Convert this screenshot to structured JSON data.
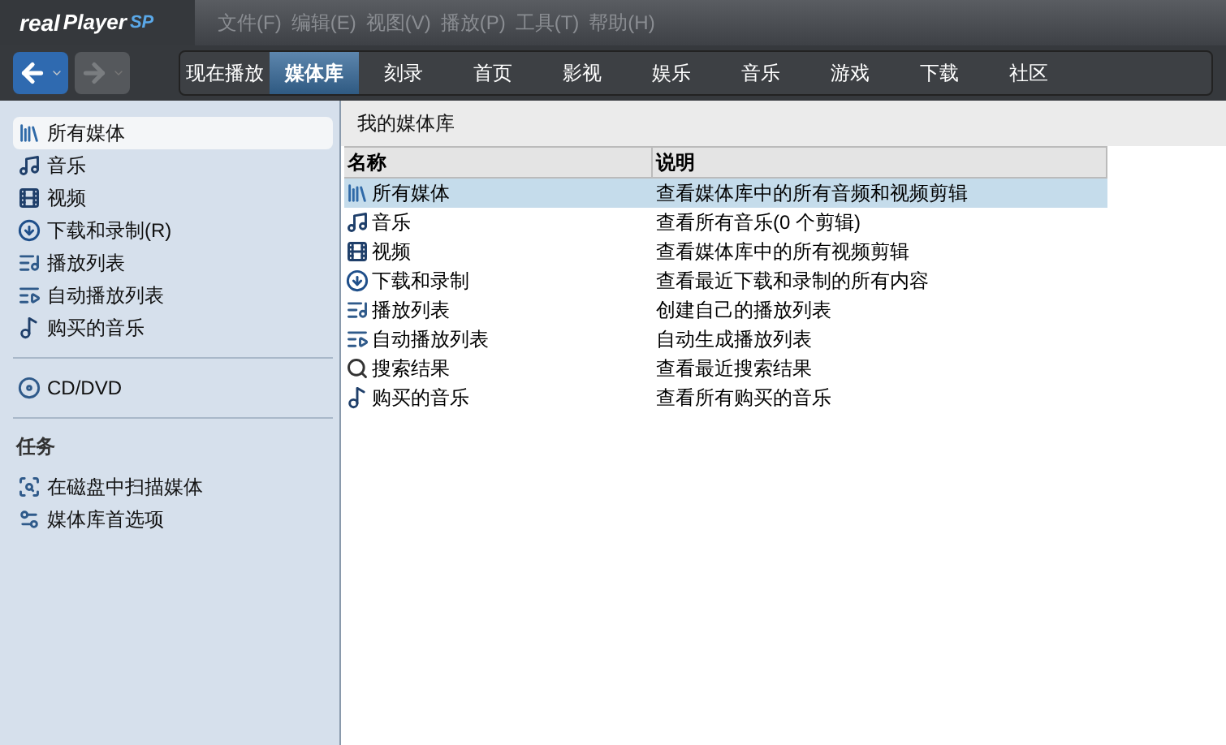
{
  "logo": {
    "brand": "real",
    "product": "Player",
    "edition": "SP"
  },
  "menu": [
    "文件(F)",
    "编辑(E)",
    "视图(V)",
    "播放(P)",
    "工具(T)",
    "帮助(H)"
  ],
  "nav": {
    "back": {
      "disabled": false
    },
    "forward": {
      "disabled": true
    }
  },
  "tabs": [
    {
      "label": "现在播放",
      "selected": false
    },
    {
      "label": "媒体库",
      "selected": true
    },
    {
      "label": "刻录",
      "selected": false
    },
    {
      "label": "首页",
      "selected": false
    },
    {
      "label": "影视",
      "selected": false
    },
    {
      "label": "娱乐",
      "selected": false
    },
    {
      "label": "音乐",
      "selected": false
    },
    {
      "label": "游戏",
      "selected": false
    },
    {
      "label": "下载",
      "selected": false
    },
    {
      "label": "社区",
      "selected": false
    }
  ],
  "sidebar": {
    "groups": [
      {
        "items": [
          {
            "label": "所有媒体",
            "kind": "all",
            "selected": true
          },
          {
            "label": "音乐",
            "kind": "music",
            "selected": false
          },
          {
            "label": "视频",
            "kind": "video",
            "selected": false
          },
          {
            "label": "下载和录制(R)",
            "kind": "download",
            "selected": false
          },
          {
            "label": "播放列表",
            "kind": "playlist",
            "selected": false
          },
          {
            "label": "自动播放列表",
            "kind": "autoplaylist",
            "selected": false
          },
          {
            "label": "购买的音乐",
            "kind": "purchased",
            "selected": false
          }
        ]
      },
      {
        "items": [
          {
            "label": "CD/DVD",
            "kind": "disc",
            "selected": false
          }
        ]
      },
      {
        "title": "任务",
        "items": [
          {
            "label": "在磁盘中扫描媒体",
            "kind": "scan",
            "selected": false
          },
          {
            "label": "媒体库首选项",
            "kind": "prefs",
            "selected": false
          }
        ]
      }
    ]
  },
  "main": {
    "title": "我的媒体库",
    "table": {
      "columns": [
        "名称",
        "说明"
      ],
      "rows": [
        {
          "name": "所有媒体",
          "kind": "all",
          "description": "查看媒体库中的所有音频和视频剪辑",
          "selected": true
        },
        {
          "name": "音乐",
          "kind": "music",
          "description": "查看所有音乐(0 个剪辑)",
          "selected": false
        },
        {
          "name": "视频",
          "kind": "video",
          "description": "查看媒体库中的所有视频剪辑",
          "selected": false
        },
        {
          "name": "下载和录制",
          "kind": "download",
          "description": "查看最近下载和录制的所有内容",
          "selected": false
        },
        {
          "name": "播放列表",
          "kind": "playlist",
          "description": "创建自己的播放列表",
          "selected": false
        },
        {
          "name": "自动播放列表",
          "kind": "autoplaylist",
          "description": "自动生成播放列表",
          "selected": false
        },
        {
          "name": "搜索结果",
          "kind": "search",
          "description": "查看最近搜索结果",
          "selected": false
        },
        {
          "name": "购买的音乐",
          "kind": "purchased",
          "description": "查看所有购买的音乐",
          "selected": false
        }
      ]
    }
  }
}
